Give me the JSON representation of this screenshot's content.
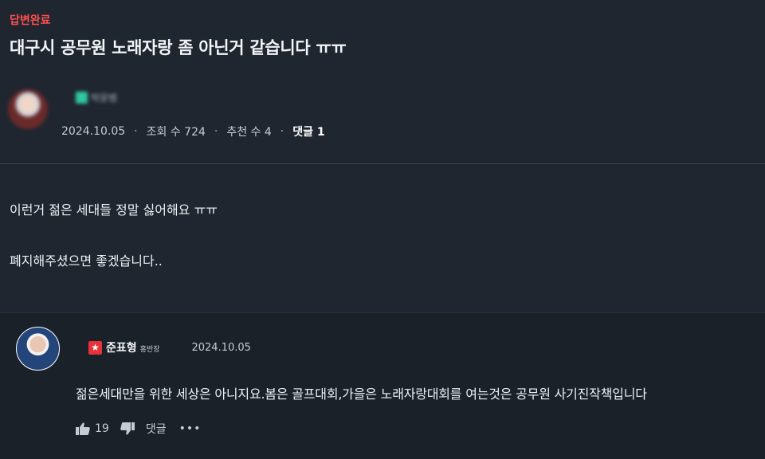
{
  "post": {
    "badge": "답변완료",
    "title": "대구시 공무원 노래자랑 좀 아닌거 같습니다 ㅠㅠ",
    "author_name": "박윤범",
    "date": "2024.10.05",
    "views": "조회 수 724",
    "recommends": "추천 수 4",
    "comments": "댓글 1",
    "separator": "·",
    "body_line1": "이런거 젊은 세대들 정말 싫어해요 ㅠㅠ",
    "body_line2": "폐지해주셨으면 좋겠습니다.."
  },
  "comment": {
    "author": "준표형",
    "role": "홍반장",
    "date": "2024.10.05",
    "text": "젊은세대만을 위한 세상은 아니지요.봄은 골프대회,가을은 노래자랑대회를 여는것은 공무원 사기진작책입니다",
    "likes": "19",
    "reply_label": "댓글",
    "more": "•••",
    "star_glyph": "★"
  },
  "colors": {
    "background": "#1f2630",
    "badge": "#ff4f4f",
    "role_star": "#e7323a"
  },
  "icons": [
    "thumbs-up-icon",
    "thumbs-down-icon",
    "more-icon",
    "star-icon"
  ]
}
